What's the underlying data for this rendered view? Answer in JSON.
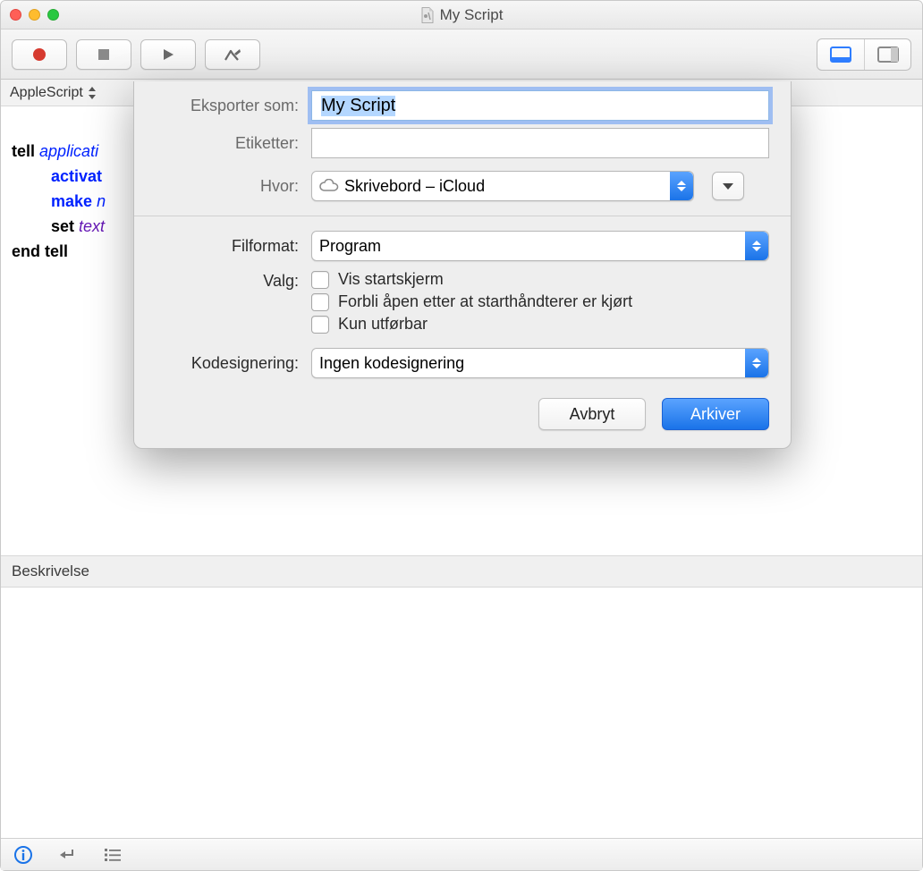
{
  "window": {
    "title": "My Script"
  },
  "langbar": {
    "language": "AppleScript"
  },
  "code": {
    "line1_kw": "tell",
    "line1_app": "applicati",
    "line2_cmd": "activat",
    "line3_cmd": "make",
    "line3_rest": "n",
    "line4_kw": "set",
    "line4_prop": "text",
    "line5_kw": "end tell"
  },
  "desc": {
    "header": "Beskrivelse"
  },
  "dialog": {
    "export_as_label": "Eksporter som:",
    "export_as_value": "My Script",
    "tags_label": "Etiketter:",
    "where_label": "Hvor:",
    "where_value": "Skrivebord – iCloud",
    "fileformat_label": "Filformat:",
    "fileformat_value": "Program",
    "options_label": "Valg:",
    "opt1": "Vis startskjerm",
    "opt2": "Forbli åpen etter at starthåndterer er kjørt",
    "opt3": "Kun utførbar",
    "codesign_label": "Kodesignering:",
    "codesign_value": "Ingen kodesignering",
    "cancel": "Avbryt",
    "save": "Arkiver"
  }
}
